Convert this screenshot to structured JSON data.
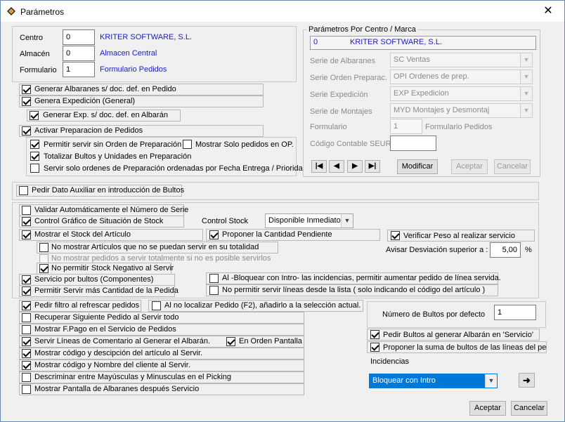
{
  "window": {
    "title": "Parámetros",
    "close_symbol": "✕"
  },
  "center": {
    "centro_label": "Centro",
    "centro_value": "0",
    "centro_name": "KRITER SOFTWARE, S.L.",
    "almacen_label": "Almacén",
    "almacen_value": "0",
    "almacen_name": "Almacen Central",
    "formulario_label": "Formulario",
    "formulario_value": "1",
    "formulario_name": "Formulario Pedidos"
  },
  "checks_top": {
    "generar_albaranes": "Generar Albaranes s/ doc. def. en Pedido",
    "genera_expedicion": "Genera Expedición (General)",
    "generar_exp": "Generar Exp. s/ doc. def. en Albarán",
    "activar_preparacion": "Activar Preparacion de Pedidos",
    "permitir_servir": "Permitir servir sin Orden de Preparación",
    "mostrar_solo": "Mostrar Solo pedidos en OP.",
    "totalizar": "Totalizar Bultos y Unidades en Preparación",
    "servir_solo": "Servir solo ordenes de Preparación ordenadas por Fecha Entrega / Prioridad"
  },
  "marca": {
    "legend": "Parámetros Por Centro / Marca",
    "code": "0",
    "name": "KRITER SOFTWARE, S.L.",
    "serie_albaranes_label": "Serie de Albaranes",
    "serie_albaranes_value": "SC Ventas",
    "serie_orden_label": "Serie Orden Preparac.",
    "serie_orden_value": "OPI Ordenes de prep.",
    "serie_expedicion_label": "Serie Expedición",
    "serie_expedicion_value": "EXP Expedicion",
    "serie_montajes_label": "Serie de Montajes",
    "serie_montajes_value": "MYD Montajes y Desmontaj",
    "formulario_label": "Formulario",
    "formulario_value": "1",
    "formulario_name": "Formulario Pedidos",
    "codigo_label": "Código Contable SEUR",
    "codigo_value": "",
    "nav_first": "|◀",
    "nav_prev": "◀",
    "nav_next": "▶",
    "nav_last": "▶|",
    "modificar": "Modificar",
    "aceptar": "Aceptar",
    "cancelar": "Cancelar"
  },
  "pedir_dato": "Pedir Dato Auxiliar en introducción de Bultos",
  "servicio": {
    "validar": "Validar Automáticamente el Número de Serie",
    "control_grafico": "Control Gráfico de Situación de Stock",
    "control_stock_label": "Control Stock",
    "control_stock_value": "Disponible Inmediato",
    "mostrar_stock": "Mostrar el Stock del Artículo",
    "proponer_cantidad": "Proponer la Cantidad Pendiente",
    "verificar_peso": "Verificar Peso al realizar servicio",
    "avisar_label": "Avisar Desviación superior a :",
    "avisar_value": "5,00",
    "avisar_unit": "%",
    "no_mostrar_1": "No mostrar Artículos que no se puedan servir en su totalidad",
    "no_mostrar_2": "No mostrar pedidos a servir totalmente si no es posible servirlos",
    "no_permitir_neg": "No permitir Stock Negativo al Servir",
    "servicio_bultos": "Servicio por bultos (Componentes)",
    "permitir_mas": "Permitir Servir más Cantidad de la Pedida",
    "al_bloquear": "Al -Bloquear con Intro- las incidencias, permitir aumentar pedido de línea servida.",
    "no_permitir_lista": "No permitir servir líneas desde la lista ( solo indicando el código del artículo )"
  },
  "bottom": {
    "pedir_filtro": "Pedir filtro al refrescar pedidos",
    "al_no_localizar": "Al no localizar Pedido (F2), añadirlo a la selección actual.",
    "recuperar": "Recuperar Siguiente Pedido al Servir todo",
    "mostrar_fpago": "Mostrar F.Pago en el Servicio de Pedidos",
    "servir_lineas": "Servir Líneas de Comentario al Generar el Albarán.",
    "en_orden": "En Orden Pantalla",
    "mostrar_codigo_art": "Mostrar código y descipción del artículo al Servir.",
    "mostrar_codigo_cli": "Mostrar código y Nombre del cliente al Servir.",
    "descriminar": "Descriminar entre Mayúsculas y Minusculas en el Picking",
    "mostrar_pantalla": "Mostrar Pantalla de Albaranes después Servicio",
    "num_bultos_label": "Número de Bultos por defecto",
    "num_bultos_value": "1",
    "pedir_bultos": "Pedir Bultos al generar Albarán en 'Servicio'",
    "proponer_suma": "Proponer la suma de bultos de las líneas del pedido",
    "incidencias_label": "Incidencias",
    "incidencias_value": "Bloquear con Intro"
  },
  "footer": {
    "aceptar": "Aceptar",
    "cancelar": "Cancelar"
  },
  "colors": {
    "accent_blue": "#1c1cc8",
    "select_highlight": "#0078d7",
    "window_bg": "#f0f0f0"
  }
}
